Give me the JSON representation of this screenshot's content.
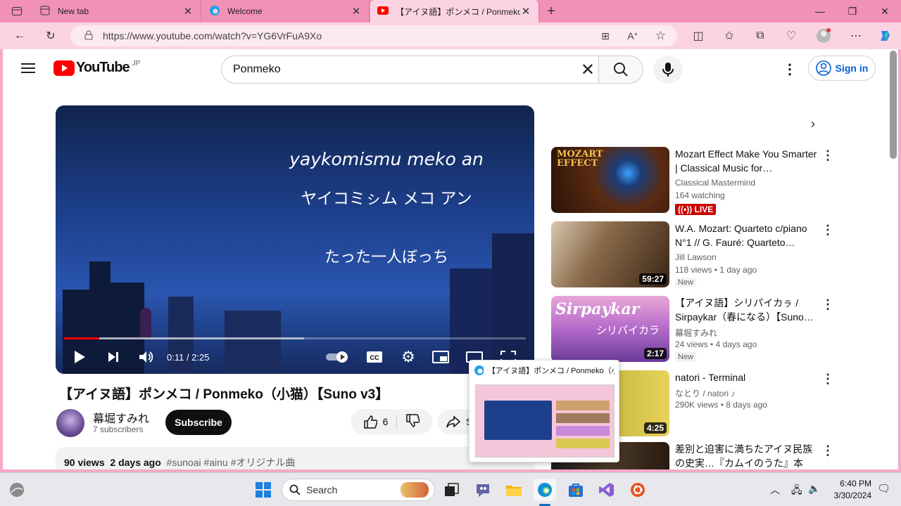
{
  "browser": {
    "tabs": [
      {
        "title": "New tab"
      },
      {
        "title": "Welcome"
      },
      {
        "title": "【アイヌ語】ポンメコ / Ponmeko（小猫）"
      }
    ],
    "url": "https://www.youtube.com/watch?v=YG6VrFuA9Xo"
  },
  "yt": {
    "logo": "YouTube",
    "region": "JP",
    "search_value": "Ponmeko",
    "signin": "Sign in"
  },
  "player": {
    "lyric1": "yaykomismu meko an",
    "lyric2": "ヤイコミㇱム メコ アン",
    "lyric3": "たった一人ぼっち",
    "time": "0:11 / 2:25",
    "progress": 0.076
  },
  "video": {
    "title": "【アイヌ語】ポンメコ / Ponmeko（小猫）【Suno v3】",
    "channel": "幕堀すみれ",
    "subscribers": "7 subscribers",
    "subscribe": "Subscribe",
    "likes": "6",
    "share": "S",
    "views": "90 views",
    "date": "2 days ago",
    "tags": "#sunoai #ainu #オリジナル曲"
  },
  "recs": [
    {
      "title": "Mozart Effect Make You Smarter | Classical Music for…",
      "channel": "Classical Mastermind",
      "meta": "164 watching",
      "live": "LIVE",
      "thumb_text": "MOZART EFFECT"
    },
    {
      "title": "W.A. Mozart: Quarteto c/piano N°1 // G. Fauré: Quarteto…",
      "channel": "Jill Lawson",
      "meta": "118 views  • 1 day ago",
      "badge": "New",
      "duration": "59:27"
    },
    {
      "title": "【アイヌ語】シリパイカㇻ / Sirpaykar（春になる）【Suno…",
      "channel": "幕堀すみれ",
      "meta": "24 views  • 4 days ago",
      "badge": "New",
      "duration": "2:17",
      "thumb_text": "Sirpaykar",
      "thumb_sub": "シリパイカラ"
    },
    {
      "title": "natori - Terminal",
      "channel": "なとり / natori ♪",
      "meta": "290K views  • 8 days ago",
      "duration": "4:25"
    },
    {
      "title": "差別と迫害に満ちたアイヌ民族の史実…『カムイのうた』本予…",
      "channel": "",
      "meta": ""
    }
  ],
  "preview": {
    "title": "【アイヌ語】ポンメコ / Ponmeko（小猫）"
  },
  "taskbar": {
    "search": "Search",
    "time": "6:40 PM",
    "date": "3/30/2024"
  }
}
